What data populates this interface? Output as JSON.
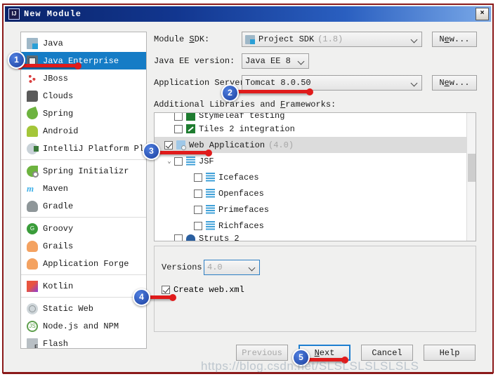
{
  "window": {
    "title": "New Module",
    "app_icon": "intellij-idea-icon",
    "close_label": "×"
  },
  "sidebar": {
    "groups": [
      {
        "items": [
          {
            "label": "Java",
            "icon": "java-icon",
            "selected": false
          },
          {
            "label": "Java Enterprise",
            "icon": "java-enterprise-icon",
            "selected": true
          },
          {
            "label": "JBoss",
            "icon": "jboss-icon",
            "selected": false
          },
          {
            "label": "Clouds",
            "icon": "clouds-icon",
            "selected": false
          },
          {
            "label": "Spring",
            "icon": "spring-icon",
            "selected": false
          },
          {
            "label": "Android",
            "icon": "android-icon",
            "selected": false
          },
          {
            "label": "IntelliJ Platform Plugin",
            "icon": "intellij-platform-plugin-icon",
            "selected": false
          }
        ]
      },
      {
        "items": [
          {
            "label": "Spring Initializr",
            "icon": "spring-initializr-icon",
            "selected": false
          },
          {
            "label": "Maven",
            "icon": "maven-icon",
            "selected": false
          },
          {
            "label": "Gradle",
            "icon": "gradle-icon",
            "selected": false
          }
        ]
      },
      {
        "items": [
          {
            "label": "Groovy",
            "icon": "groovy-icon",
            "selected": false
          },
          {
            "label": "Grails",
            "icon": "grails-icon",
            "selected": false
          },
          {
            "label": "Application Forge",
            "icon": "application-forge-icon",
            "selected": false
          }
        ]
      },
      {
        "items": [
          {
            "label": "Kotlin",
            "icon": "kotlin-icon",
            "selected": false
          }
        ]
      },
      {
        "items": [
          {
            "label": "Static Web",
            "icon": "static-web-icon",
            "selected": false
          },
          {
            "label": "Node.js and NPM",
            "icon": "nodejs-npm-icon",
            "selected": false
          },
          {
            "label": "Flash",
            "icon": "flash-icon",
            "selected": false
          }
        ]
      }
    ]
  },
  "form": {
    "module_sdk": {
      "label_pre": "Module ",
      "label_accel": "S",
      "label_post": "DK:",
      "value": "Project SDK",
      "value_muted": "(1.8)",
      "new_button": {
        "pre": "N",
        "accel": "e",
        "post": "w..."
      }
    },
    "java_ee_version": {
      "label": "Java EE version:",
      "value": "Java EE 8"
    },
    "application_server": {
      "label_pre": "Application Ser",
      "label_accel": "v",
      "label_post": "er:",
      "value": "Tomcat 8.0.50",
      "new_button": {
        "pre": "N",
        "accel": "e",
        "post": "w..."
      }
    },
    "additional_libraries_label": {
      "pre": "Additional Libraries and ",
      "accel": "F",
      "post": "rameworks:"
    }
  },
  "tree": {
    "rows": [
      {
        "label": "Stymeleaf testing",
        "indent": 1,
        "checked": false,
        "icon": "green-box-icon",
        "clipped": "top",
        "arrow": ""
      },
      {
        "label": "Tiles 2 integration",
        "indent": 1,
        "checked": false,
        "icon": "tiles-icon",
        "arrow": ""
      },
      {
        "label": "Web Application",
        "muted": "(4.0)",
        "indent": 0,
        "checked": true,
        "icon": "web-application-icon",
        "selected": true,
        "arrow": ""
      },
      {
        "label": "JSF",
        "indent": 1,
        "checked": false,
        "icon": "jsf-icon",
        "arrow": "⌄"
      },
      {
        "label": "Icefaces",
        "indent": 2,
        "checked": false,
        "icon": "jsf-icon",
        "arrow": ""
      },
      {
        "label": "Openfaces",
        "indent": 2,
        "checked": false,
        "icon": "jsf-icon",
        "arrow": ""
      },
      {
        "label": "Primefaces",
        "indent": 2,
        "checked": false,
        "icon": "jsf-icon",
        "arrow": ""
      },
      {
        "label": "Richfaces",
        "indent": 2,
        "checked": false,
        "icon": "jsf-icon",
        "arrow": ""
      },
      {
        "label": "Struts 2",
        "indent": 1,
        "checked": false,
        "icon": "struts-icon",
        "clipped": "bottom",
        "arrow": ""
      }
    ]
  },
  "versions_panel": {
    "versions_label": "Versions:",
    "versions_value": "4.0",
    "create_webxml_label": "Create web.xml",
    "create_webxml_checked": true
  },
  "footer": {
    "previous": "Previous",
    "next": {
      "pre": "",
      "accel": "N",
      "post": "ext"
    },
    "cancel": "Cancel",
    "help": "Help"
  },
  "annotations": {
    "badges": [
      {
        "number": "1",
        "target": "sidebar-item-java-enterprise"
      },
      {
        "number": "2",
        "target": "application-server-combo"
      },
      {
        "number": "3",
        "target": "tree-row-web-application"
      },
      {
        "number": "4",
        "target": "create-webxml-checkbox"
      },
      {
        "number": "5",
        "target": "next-button"
      }
    ]
  },
  "watermark": "https://blog.csdn.net/SLSLSLSLSLSLS",
  "colors": {
    "title_bar_start": "#0a246a",
    "title_bar_end": "#7aa9e8",
    "selection": "#157cc6",
    "annotation_red": "#e01b1b",
    "badge_blue": "#1b3f9e",
    "focus_blue": "#1e7fd0",
    "frame_red": "#8b1a1a"
  }
}
